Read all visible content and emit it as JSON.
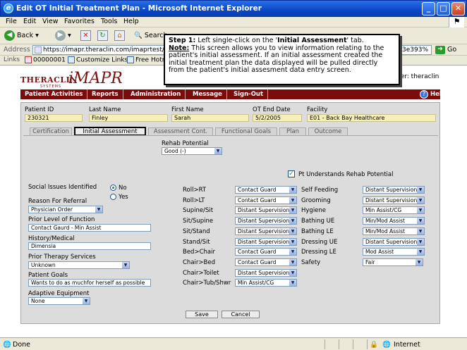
{
  "window": {
    "title": "Edit OT Initial Treatment Plan - Microsoft Internet Explorer"
  },
  "menu": [
    "File",
    "Edit",
    "View",
    "Favorites",
    "Tools",
    "Help"
  ],
  "toolbar": {
    "back": "Back",
    "search": "Search"
  },
  "address": {
    "label": "Address",
    "url": "https://imapr.theraclin.com/imaprtest/OT701/",
    "url_end": "%3e393%",
    "go": "Go"
  },
  "links": {
    "label": "Links",
    "items": [
      "00000001",
      "Customize Links",
      "Free Hotmail"
    ]
  },
  "app": {
    "logo": "THERACLIN",
    "logo_sub": "SYSTEMS",
    "product": "iMAPR",
    "user_label": "ser: theraclin"
  },
  "nav": [
    "Patient Activities",
    "Reports",
    "Administration",
    "Message",
    "Sign-Out",
    "Help"
  ],
  "patient": {
    "labels": [
      "Patient ID",
      "Last Name",
      "First Name",
      "OT End Date",
      "Facility"
    ],
    "values": [
      "230321",
      "Finley",
      "Sarah",
      "5/2/2005",
      "E01 - Back Bay Healthcare"
    ]
  },
  "tabs": [
    "Certification",
    "Initial Assessment",
    "Assessment Cont.",
    "Functional Goals",
    "Plan",
    "Outcome"
  ],
  "form": {
    "rehab_potential_label": "Rehab Potential",
    "rehab_potential": "Good (-)",
    "pt_understands": "Pt Understands Rehab Potential",
    "social_label": "Social Issues Identified",
    "no": "No",
    "yes": "Yes",
    "referral_label": "Reason For Referral",
    "referral": "Physician Order",
    "prior_level_label": "Prior Level of Function",
    "prior_level": "Contact Gaurd - Min Assist",
    "history_label": "History/Medical",
    "history": "Dimensia",
    "prior_therapy_label": "Prior Therapy Services",
    "prior_therapy": "Unknown",
    "goals_label": "Patient Goals",
    "goals": "Wants to do as muchfor herself as possible",
    "adaptive_label": "Adaptive Equipment",
    "adaptive": "None",
    "mobility": [
      {
        "label": "Roll>RT",
        "value": "Contact Guard"
      },
      {
        "label": "Roll>LT",
        "value": "Contact Guard"
      },
      {
        "label": "Supine/Sit",
        "value": "Distant Supervision"
      },
      {
        "label": "Sit/Supine",
        "value": "Distant Supervision"
      },
      {
        "label": "Sit/Stand",
        "value": "Distant Supervision"
      },
      {
        "label": "Stand/Sit",
        "value": "Distant Supervision"
      },
      {
        "label": "Bed>Chair",
        "value": "Contact Guard"
      },
      {
        "label": "Chair>Bed",
        "value": "Contact Guard"
      },
      {
        "label": "Chair>Toilet",
        "value": "Distant Supervision"
      },
      {
        "label": "Chair>Tub/Shwr",
        "value": "Min Assist/CG"
      }
    ],
    "adl": [
      {
        "label": "Self Feeding",
        "value": "Distant Supervision"
      },
      {
        "label": "Grooming",
        "value": "Distant Supervision"
      },
      {
        "label": "Hygiene",
        "value": "Min Assist/CG"
      },
      {
        "label": "Bathing UE",
        "value": "Min/Mod Assist"
      },
      {
        "label": "Bathing LE",
        "value": "Min/Mod Assist"
      },
      {
        "label": "Dressing UE",
        "value": "Distant Supervision"
      },
      {
        "label": "Dressing LE",
        "value": "Mod Assist"
      },
      {
        "label": "Safety",
        "value": "Fair"
      }
    ],
    "save": "Save",
    "cancel": "Cancel"
  },
  "callout": {
    "step": "Step 1:",
    "step_text": " Left single-click on the '",
    "tab_name": "Initial Assessment",
    "step_end": "' tab.",
    "note": "Note:",
    "note_text": " This screen allows you to view information relating to the patient's initial assessment. If an initial assessment created the initial treatment plan the data displayed will be pulled directly from the patient's initial assesment data entry screen."
  },
  "status": {
    "left": "Done",
    "zone": "Internet"
  }
}
